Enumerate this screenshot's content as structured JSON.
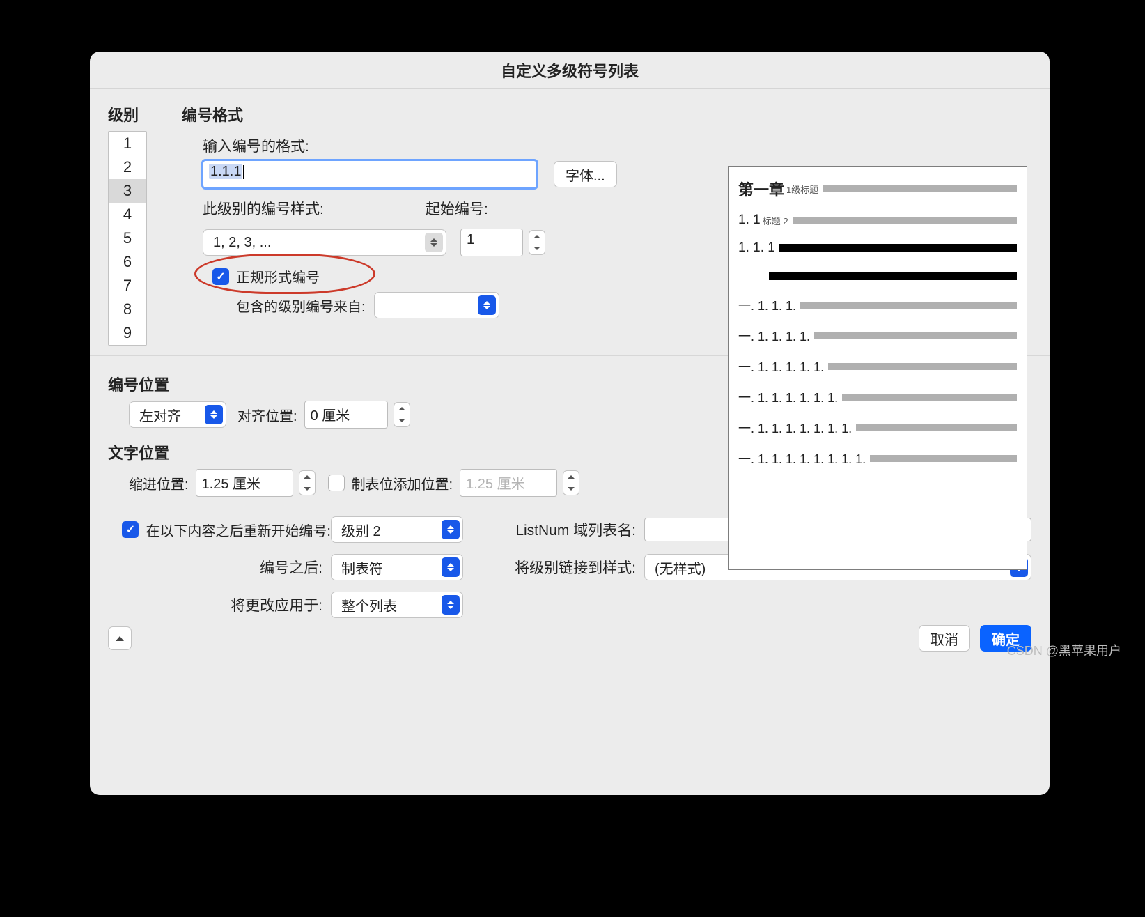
{
  "dialog": {
    "title": "自定义多级符号列表"
  },
  "level_header": "级别",
  "format_header": "编号格式",
  "levels": [
    "1",
    "2",
    "3",
    "4",
    "5",
    "6",
    "7",
    "8",
    "9"
  ],
  "selected_level_index": 2,
  "format": {
    "enter_label": "输入编号的格式:",
    "value_highlight": "1.1.1",
    "value_suffix": "",
    "font_button": "字体...",
    "style_label": "此级别的编号样式:",
    "style_value": "1, 2, 3, ...",
    "start_label": "起始编号:",
    "start_value": "1",
    "legal_label": "正规形式编号",
    "legal_checked": true,
    "include_label": "包含的级别编号来自:",
    "include_value": ""
  },
  "number_position": {
    "section": "编号位置",
    "align_value": "左对齐",
    "align_at_label": "对齐位置:",
    "align_at_value": "0 厘米"
  },
  "text_position": {
    "section": "文字位置",
    "indent_label": "缩进位置:",
    "indent_value": "1.25 厘米",
    "tab_add_label": "制表位添加位置:",
    "tab_add_value": "1.25 厘米",
    "tab_add_checked": false
  },
  "restart": {
    "checked": true,
    "label": "在以下内容之后重新开始编号:",
    "value": "级别 2"
  },
  "listnum_label": "ListNum 域列表名:",
  "listnum_value": "",
  "after_number_label": "编号之后:",
  "after_number_value": "制表符",
  "link_style_label": "将级别链接到样式:",
  "link_style_value": "(无样式)",
  "apply_to_label": "将更改应用于:",
  "apply_to_value": "整个列表",
  "buttons": {
    "cancel": "取消",
    "ok": "确定"
  },
  "preview": {
    "l1_num": "第一章",
    "l1_sub": "1级标题",
    "l2_num": "1. 1",
    "l2_sub": "标题 2",
    "l3_num": "1. 1. 1",
    "l5": "一. 1. 1. 1.",
    "l6": "一. 1. 1. 1. 1.",
    "l7": "一. 1. 1. 1. 1. 1.",
    "l8": "一. 1. 1. 1. 1. 1. 1.",
    "l9": "一. 1. 1. 1. 1. 1. 1. 1.",
    "l10": "一. 1. 1. 1. 1. 1. 1. 1. 1."
  },
  "watermark": "CSDN @黑苹果用户"
}
